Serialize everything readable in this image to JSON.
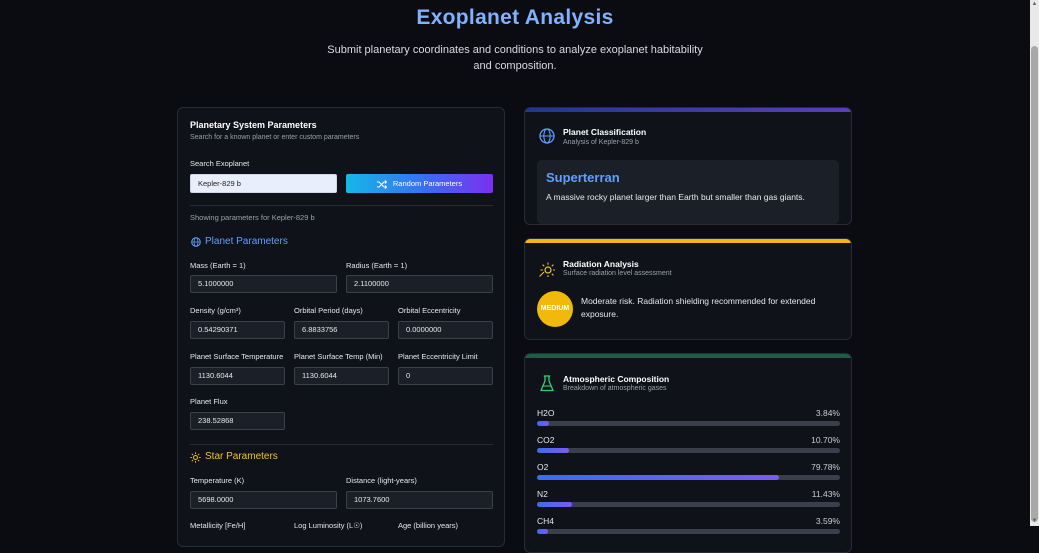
{
  "header": {
    "title": "Exoplanet Analysis",
    "subtitle": "Submit planetary coordinates and conditions to analyze exoplanet habitability and composition."
  },
  "left": {
    "title": "Planetary System Parameters",
    "subtitle": "Search for a known planet or enter custom parameters",
    "search_label": "Search Exoplanet",
    "search_value": "Kepler-829 b",
    "random_label": "Random Parameters",
    "showing": "Showing parameters for Kepler-829 b",
    "planet_section": "Planet Parameters",
    "star_section": "Star Parameters",
    "fields": {
      "mass": {
        "label": "Mass (Earth = 1)",
        "value": "5.1000000"
      },
      "radius": {
        "label": "Radius (Earth = 1)",
        "value": "2.1100000"
      },
      "density": {
        "label": "Density (g/cm³)",
        "value": "0.54290371"
      },
      "period": {
        "label": "Orbital Period (days)",
        "value": "6.8833756"
      },
      "eccentricity": {
        "label": "Orbital Eccentricity",
        "value": "0.0000000"
      },
      "surface_temp": {
        "label": "Planet Surface Temperature",
        "value": "1130.6044"
      },
      "surface_temp_min": {
        "label": "Planet Surface Temp (Min)",
        "value": "1130.6044"
      },
      "ecc_limit": {
        "label": "Planet Eccentricity Limit",
        "value": "0"
      },
      "flux": {
        "label": "Planet Flux",
        "value": "238.52868"
      },
      "star_temp": {
        "label": "Temperature (K)",
        "value": "5698.0000"
      },
      "distance": {
        "label": "Distance (light-years)",
        "value": "1073.7600"
      },
      "metallicity": {
        "label": "Metallicity [Fe/H]"
      },
      "luminosity": {
        "label": "Log Luminosity (L☉)"
      },
      "age": {
        "label": "Age (billion years)"
      }
    }
  },
  "classification": {
    "title": "Planet Classification",
    "subtitle": "Analysis of Kepler-829 b",
    "type": "Superterran",
    "description": "A massive rocky planet larger than Earth but smaller than gas giants.",
    "accent": "#3b3fb8"
  },
  "radiation": {
    "title": "Radiation Analysis",
    "subtitle": "Surface radiation level assessment",
    "level": "MEDIUM",
    "text": "Moderate risk. Radiation shielding recommended for extended exposure.",
    "accent": "#f0b90b"
  },
  "atmosphere": {
    "title": "Atmospheric Composition",
    "subtitle": "Breakdown of atmospheric gases",
    "accent": "#1f7a4c",
    "gases": [
      {
        "name": "H2O",
        "value": "3.84%",
        "pct": 3.84
      },
      {
        "name": "CO2",
        "value": "10.70%",
        "pct": 10.7
      },
      {
        "name": "O2",
        "value": "79.78%",
        "pct": 79.78
      },
      {
        "name": "N2",
        "value": "11.43%",
        "pct": 11.43
      },
      {
        "name": "CH4",
        "value": "3.59%",
        "pct": 3.59
      }
    ]
  }
}
